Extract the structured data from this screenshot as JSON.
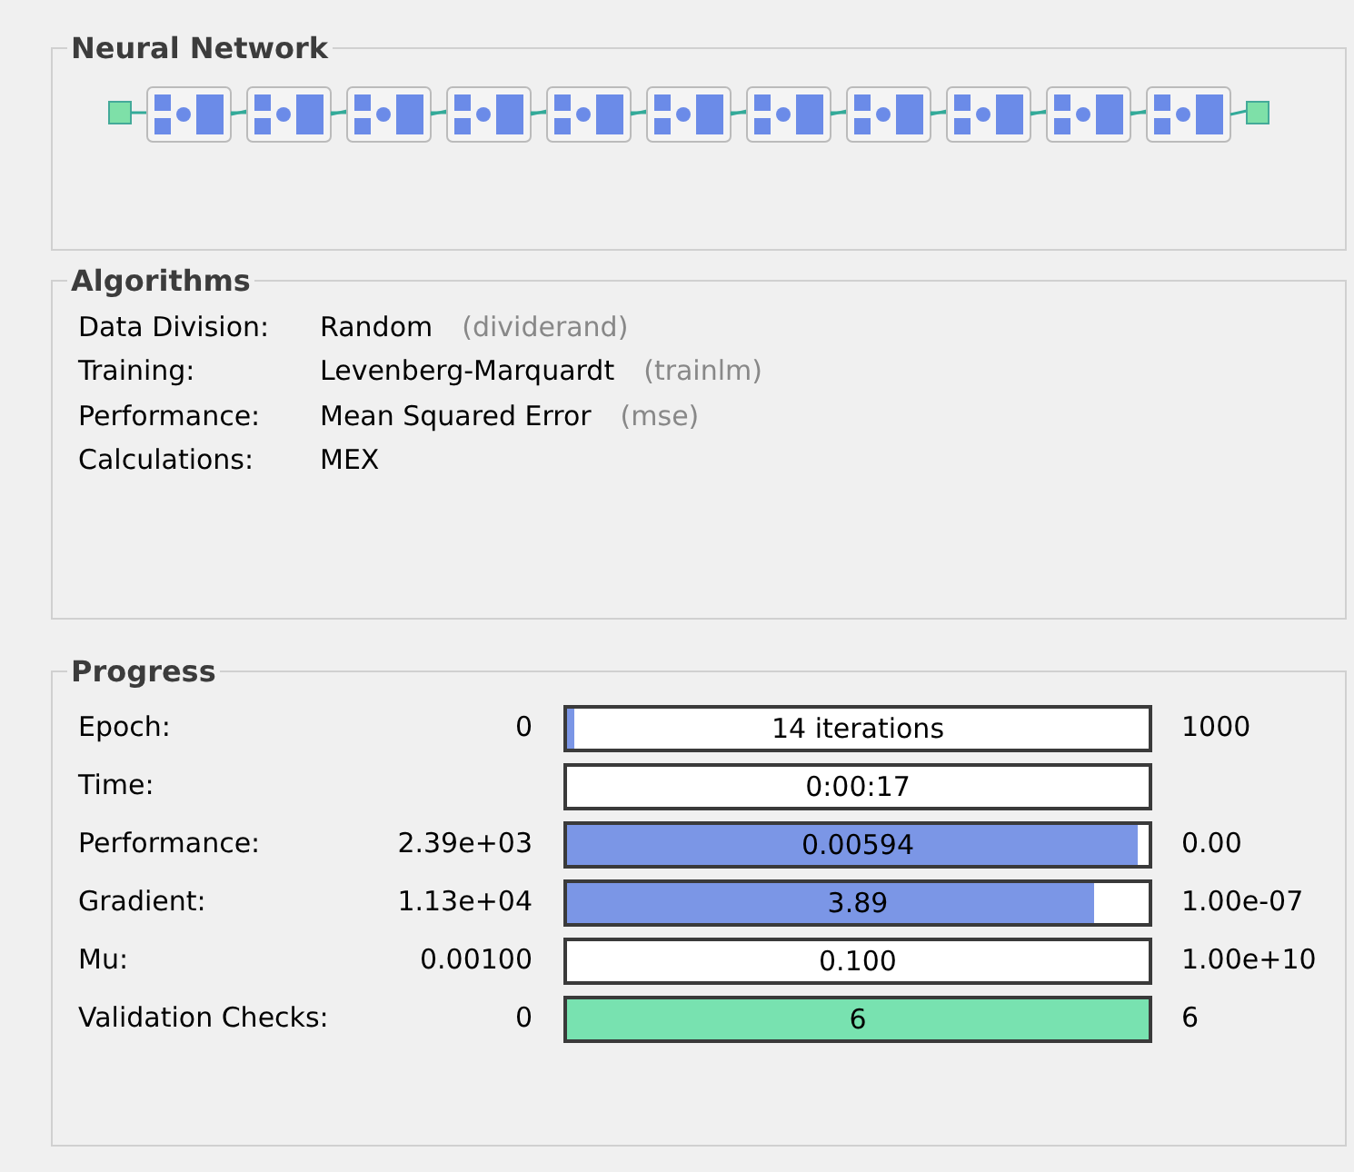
{
  "sections": [
    {
      "title": "Neural Network"
    },
    {
      "title": "Algorithms"
    },
    {
      "title": "Progress"
    }
  ],
  "algorithms": [
    {
      "label": "Data Division:",
      "value": "Random",
      "hint": "(dividerand)"
    },
    {
      "label": "Training:",
      "value": "Levenberg-Marquardt",
      "hint": "(trainlm)"
    },
    {
      "label": "Performance:",
      "value": "Mean Squared Error",
      "hint": "(mse)"
    },
    {
      "label": "Calculations:",
      "value": "MEX"
    }
  ],
  "progress": [
    {
      "label": "Epoch:",
      "start": "0",
      "reading": "14 iterations",
      "end": "1000",
      "kind": "measure",
      "level": 0.014
    },
    {
      "label": "Time:",
      "reading": "0:00:17",
      "kind": "plain"
    },
    {
      "label": "Performance:",
      "start": "2.39e+03",
      "reading": "0.00594",
      "end": "0.00",
      "kind": "measure",
      "level": 0.98
    },
    {
      "label": "Gradient:",
      "start": "1.13e+04",
      "reading": "3.89",
      "end": "1.00e-07",
      "kind": "measure",
      "level": 0.905
    },
    {
      "label": "Mu:",
      "start": "0.00100",
      "reading": "0.100",
      "end": "1.00e+10",
      "kind": "plain"
    },
    {
      "label": "Validation Checks:",
      "start": "0",
      "reading": "6",
      "end": "6",
      "kind": "checks",
      "level": 1
    }
  ]
}
